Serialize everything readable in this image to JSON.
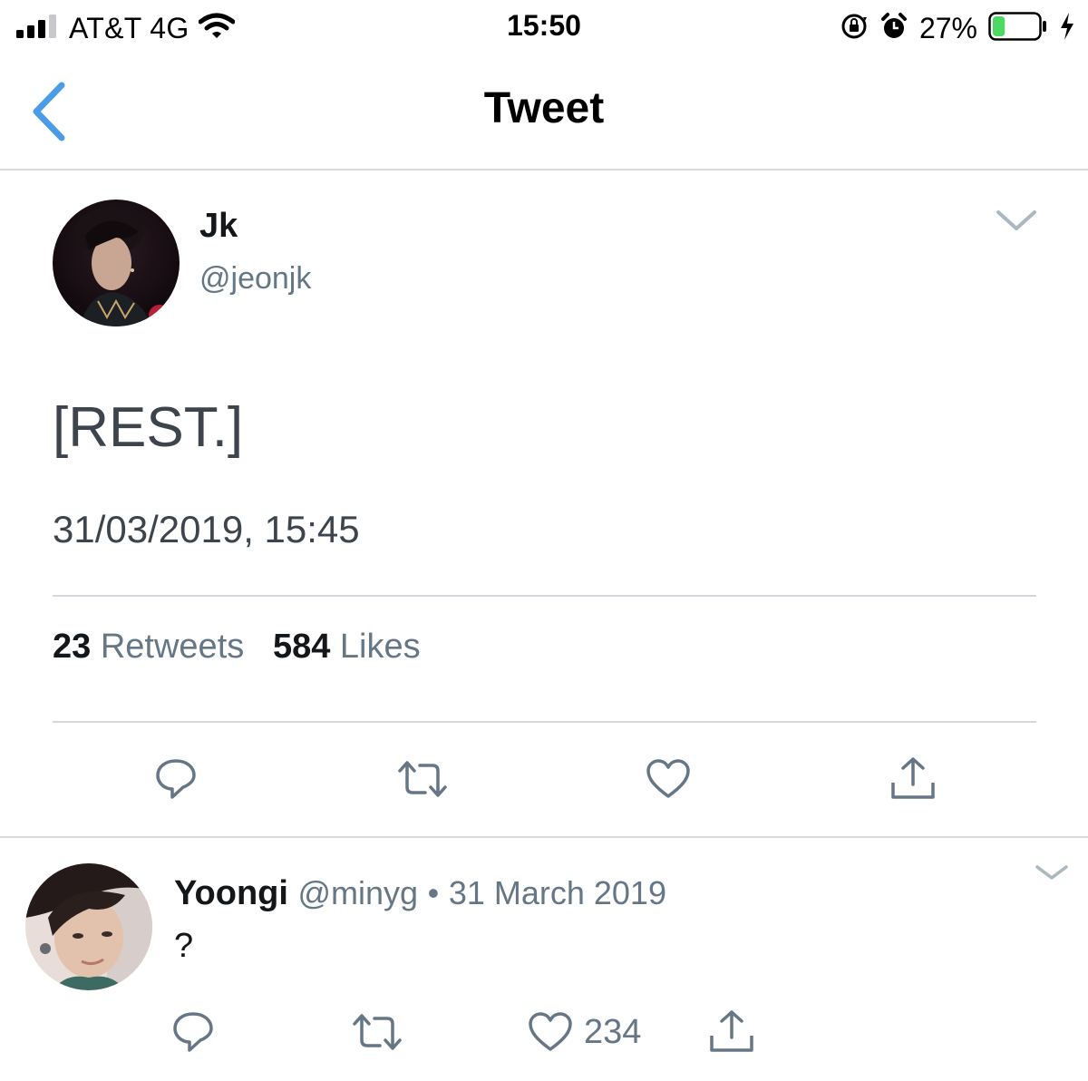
{
  "status_bar": {
    "carrier": "AT&T 4G",
    "time": "15:50",
    "battery": "27%",
    "battery_level": 0.27,
    "icons": [
      "signal-icon",
      "wifi-icon",
      "orientation-lock-icon",
      "alarm-icon",
      "battery-icon",
      "charging-icon"
    ]
  },
  "nav": {
    "title": "Tweet",
    "back_icon": "back-chevron-icon"
  },
  "tweet": {
    "author_name": "Jk",
    "author_handle": "@jeonjk",
    "text": "[REST.]",
    "timestamp": "31/03/2019, 15:45",
    "retweets_count": "23",
    "retweets_label": "Retweets",
    "likes_count": "584",
    "likes_label": "Likes",
    "actions": [
      "reply-icon",
      "retweet-icon",
      "like-icon",
      "share-icon"
    ]
  },
  "reply": {
    "author_name": "Yoongi",
    "author_handle": "@minyg",
    "separator": "•",
    "date": "31 March 2019",
    "text": "?",
    "like_count": "234"
  },
  "colors": {
    "accent_blue": "#4a9be8",
    "text_primary": "#14171a",
    "text_secondary": "#657786",
    "divider": "#d4d8dc",
    "battery_green": "#4cd964"
  }
}
